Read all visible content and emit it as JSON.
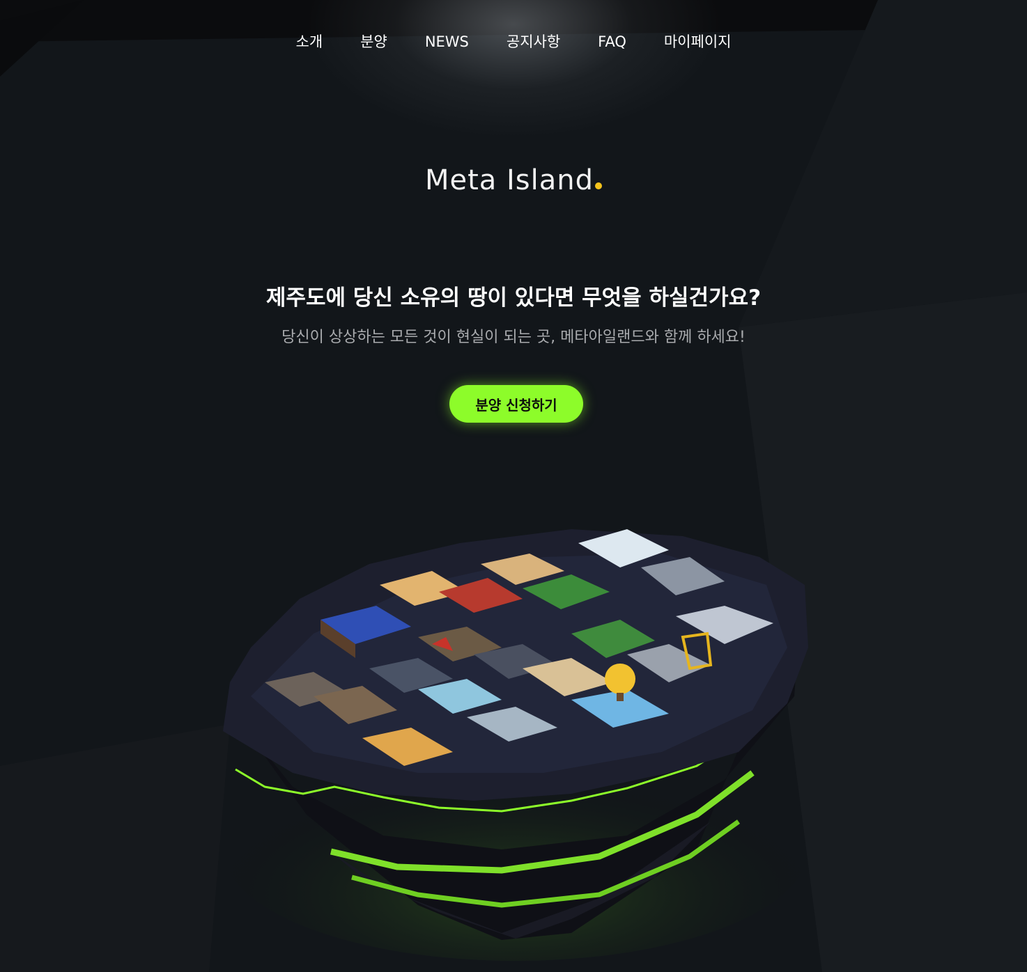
{
  "nav": {
    "items": [
      "소개",
      "분양",
      "NEWS",
      "공지사항",
      "FAQ",
      "마이페이지"
    ]
  },
  "logo": {
    "text": "Meta Island",
    "dot_color": "#f5c31c"
  },
  "hero": {
    "headline": "제주도에 당신 소유의 땅이 있다면 무엇을 하실건가요?",
    "subline": "당신이 상상하는 모든 것이 현실이 되는 곳, 메타아일랜드와 함께 하세요!",
    "cta_label": "분양 신청하기"
  },
  "colors": {
    "background": "#12161a",
    "accent_green": "#8dfc2a",
    "subtext": "#a9abae"
  }
}
